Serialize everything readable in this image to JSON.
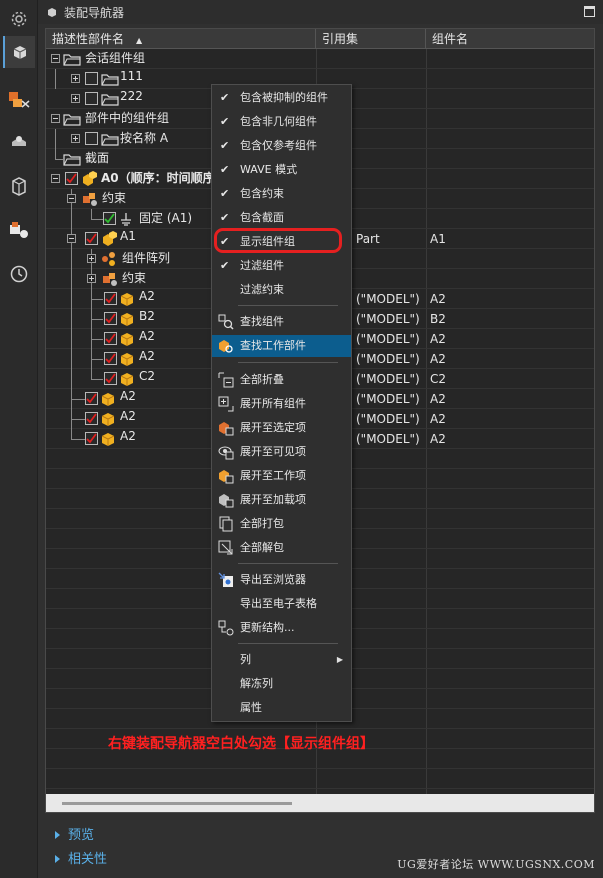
{
  "window": {
    "title": "装配导航器"
  },
  "columns": [
    "描述性部件名",
    "引用集",
    "组件名"
  ],
  "tree": [
    {
      "label": "会话组件组",
      "ref": "",
      "name": ""
    },
    {
      "label": "111",
      "ref": "",
      "name": ""
    },
    {
      "label": "222",
      "ref": "",
      "name": ""
    },
    {
      "label": "部件中的组件组",
      "ref": "",
      "name": ""
    },
    {
      "label": "按名称 A",
      "ref": "",
      "name": ""
    },
    {
      "label": "截面",
      "ref": "",
      "name": ""
    },
    {
      "label": "A0（顺序：时间顺序）",
      "ref": "",
      "name": ""
    },
    {
      "label": "约束",
      "ref": "",
      "name": ""
    },
    {
      "label": "固定 (A1)",
      "ref": "",
      "name": ""
    },
    {
      "label": "A1",
      "ref": "Part",
      "name": "A1"
    },
    {
      "label": "组件阵列",
      "ref": "",
      "name": ""
    },
    {
      "label": "约束",
      "ref": "",
      "name": ""
    },
    {
      "label": "A2",
      "ref": "(\"MODEL\")",
      "name": "A2"
    },
    {
      "label": "B2",
      "ref": "(\"MODEL\")",
      "name": "B2"
    },
    {
      "label": "A2",
      "ref": "(\"MODEL\")",
      "name": "A2"
    },
    {
      "label": "A2",
      "ref": "(\"MODEL\")",
      "name": "A2"
    },
    {
      "label": "C2",
      "ref": "(\"MODEL\")",
      "name": "C2"
    },
    {
      "label": "A2",
      "ref": "(\"MODEL\")",
      "name": "A2"
    },
    {
      "label": "A2",
      "ref": "(\"MODEL\")",
      "name": "A2"
    },
    {
      "label": "A2",
      "ref": "(\"MODEL\")",
      "name": "A2"
    }
  ],
  "menu": [
    {
      "label": "包含被抑制的组件",
      "checked": true
    },
    {
      "label": "包含非几何组件",
      "checked": true
    },
    {
      "label": "包含仅参考组件",
      "checked": true
    },
    {
      "label": "WAVE 模式",
      "checked": true
    },
    {
      "label": "包含约束",
      "checked": true
    },
    {
      "label": "包含截面",
      "checked": true
    },
    {
      "label": "显示组件组",
      "checked": true
    },
    {
      "label": "过滤组件",
      "checked": true
    },
    {
      "label": "过滤约束",
      "checked": false
    },
    {
      "label": "查找组件"
    },
    {
      "label": "查找工作部件"
    },
    {
      "label": "全部折叠"
    },
    {
      "label": "展开所有组件"
    },
    {
      "label": "展开至选定项"
    },
    {
      "label": "展开至可见项"
    },
    {
      "label": "展开至工作项"
    },
    {
      "label": "展开至加载项"
    },
    {
      "label": "全部打包"
    },
    {
      "label": "全部解包"
    },
    {
      "label": "导出至浏览器"
    },
    {
      "label": "导出至电子表格"
    },
    {
      "label": "更新结构..."
    },
    {
      "label": "列"
    },
    {
      "label": "解冻列"
    },
    {
      "label": "属性"
    }
  ],
  "check_mark": "✔",
  "submenu_arrow": "▶",
  "annotation": "右键装配导航器空白处勾选【显示组件组】",
  "sections": {
    "preview": "预览",
    "dependencies": "相关性"
  },
  "watermark": "UG爱好者论坛 WWW.UGSNX.COM",
  "colors": {
    "highlight": "#e52020",
    "menu_selected": "#0c5d8e",
    "section_text": "#5ab0e8",
    "checkbox_tick_red": "#e02020",
    "checkbox_tick_green": "#30c030"
  }
}
